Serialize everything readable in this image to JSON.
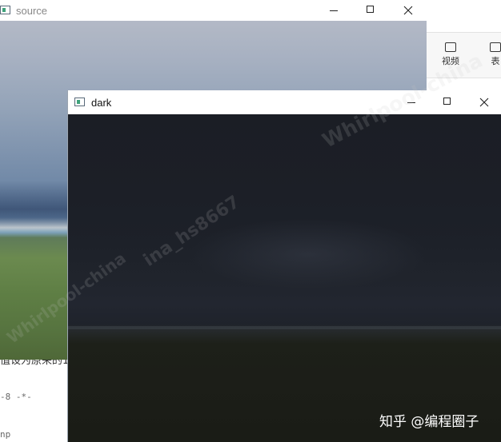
{
  "background_editor": {
    "text_line": "值设为原来的1",
    "code_line_1": "-8 -*-",
    "code_line_2": "np"
  },
  "toolbar": {
    "items": [
      {
        "label": "视频",
        "icon": "video-icon"
      },
      {
        "label": "表",
        "icon": "table-icon"
      }
    ]
  },
  "windows": {
    "source": {
      "title": "source"
    },
    "dark": {
      "title": "dark"
    }
  },
  "watermarks": {
    "top": "Whirlpool-china",
    "mid": "ina_hs8667",
    "left": "Whirlpool-china"
  },
  "credit": "知乎 @编程圈子"
}
